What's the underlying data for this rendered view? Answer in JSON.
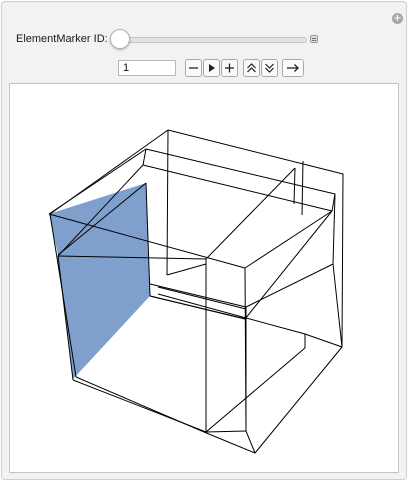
{
  "controls": {
    "label": "ElementMarker ID: 1",
    "field_value": "1",
    "slider_value_fraction": 0.0
  },
  "colors": {
    "panel_bg": "#f2f2f2",
    "highlighted_face": "#7f9fcd",
    "edge": "#000000"
  },
  "icons": {
    "add": "plus-circle-icon",
    "minus": "minus-icon",
    "play": "play-icon",
    "plus": "plus-icon",
    "faster": "double-chevron-up-icon",
    "slower": "double-chevron-down-icon",
    "direction": "right-arrow-icon"
  }
}
